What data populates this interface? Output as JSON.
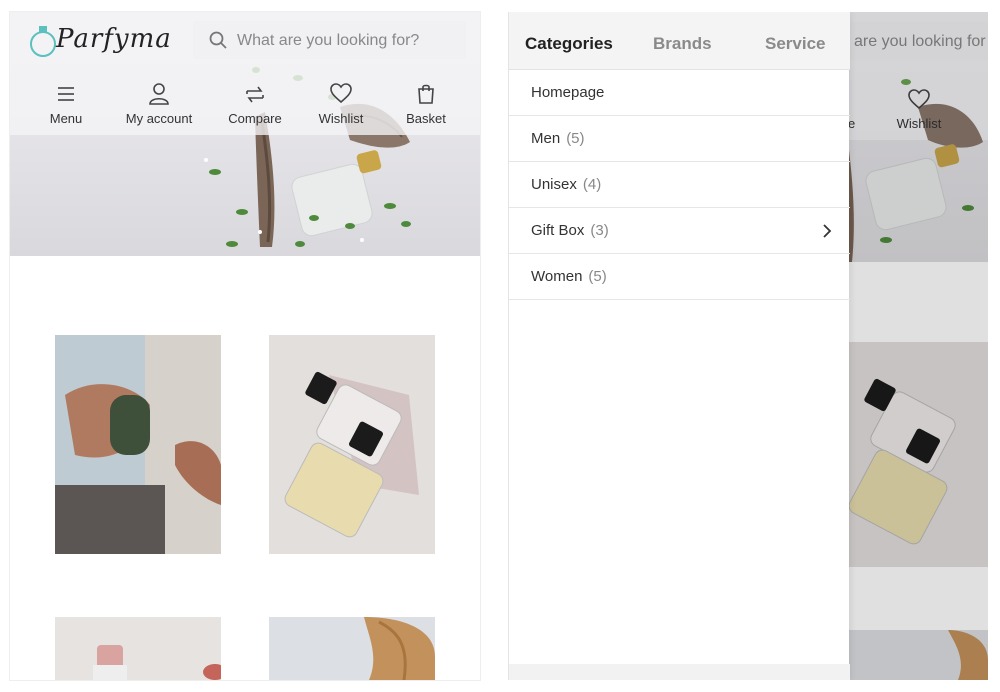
{
  "brand": {
    "logo_text": "Parfyma",
    "accent": "#5bc0be"
  },
  "search": {
    "placeholder": "What are you looking for?",
    "partial_placeholder": "are you looking for"
  },
  "nav": {
    "menu": "Menu",
    "account": "My account",
    "compare": "Compare",
    "wishlist": "Wishlist",
    "basket": "Basket",
    "partial_compare": "e"
  },
  "drawer": {
    "tabs": [
      "Categories",
      "Brands",
      "Service"
    ],
    "active_tab": "Categories",
    "categories": [
      {
        "name": "Homepage",
        "count": ""
      },
      {
        "name": "Men",
        "count": "(5)"
      },
      {
        "name": "Unisex",
        "count": "(4)"
      },
      {
        "name": "Gift Box",
        "count": "(3)",
        "has_children": true
      },
      {
        "name": "Women",
        "count": "(5)"
      }
    ]
  }
}
